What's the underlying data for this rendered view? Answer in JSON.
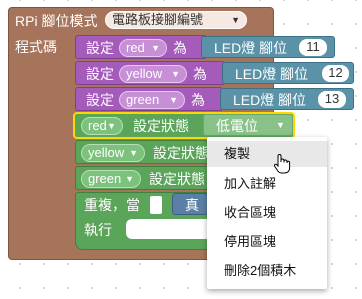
{
  "workspace": {
    "mode_block": {
      "label": "RPi 腳位模式",
      "mode_value": "電路板接腳編號",
      "program_label": "程式碼"
    },
    "set_blocks": [
      {
        "label": "設定",
        "var": "red",
        "as": "為",
        "pin_label": "LED燈 腳位",
        "pin": "11"
      },
      {
        "label": "設定",
        "var": "yellow",
        "as": "為",
        "pin_label": "LED燈 腳位",
        "pin": "12"
      },
      {
        "label": "設定",
        "var": "green",
        "as": "為",
        "pin_label": "LED燈 腳位",
        "pin": "13"
      }
    ],
    "state_blocks": [
      {
        "var": "red",
        "label": "設定狀態",
        "value": "低電位"
      },
      {
        "var": "yellow",
        "label": "設定狀態"
      },
      {
        "var": "green",
        "label": "設定狀態"
      }
    ],
    "repeat_block": {
      "label": "重複，當",
      "condition": "真",
      "do_label": "執行"
    }
  },
  "context_menu": {
    "items": [
      "複製",
      "加入註解",
      "收合區塊",
      "停用區塊",
      "刪除2個積木"
    ],
    "hovered_index": 0
  },
  "colors": {
    "mode_block": "#a5745b",
    "variable_block": "#a55bba",
    "pin_block": "#5a93a8",
    "state_block": "#5ba55b",
    "selection_outline": "#ffd700",
    "menu_hover": "#e8e8e8"
  },
  "icons": {
    "dropdown": "triangle-down-icon",
    "cursor": "hand-pointer-icon"
  }
}
